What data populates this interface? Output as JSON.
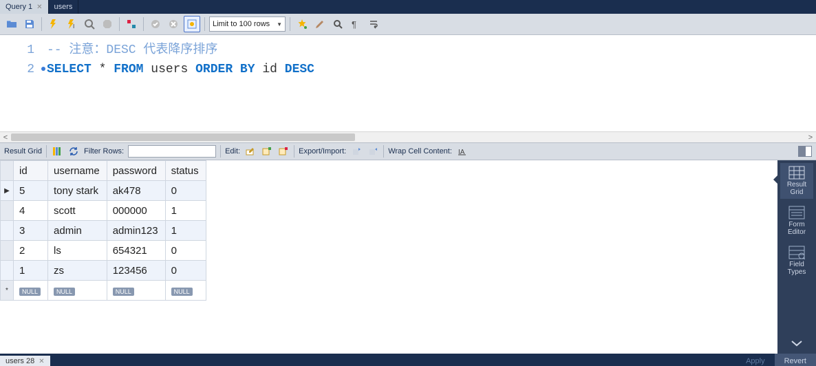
{
  "tabs": {
    "main": [
      {
        "label": "Query 1",
        "active": true,
        "closable": true
      },
      {
        "label": "users",
        "active": false,
        "closable": false
      }
    ]
  },
  "toolbar": {
    "limit_label": "Limit to 100 rows"
  },
  "editor": {
    "lines": [
      {
        "num": "1",
        "bp": false,
        "comment": "-- 注意：DESC 代表降序排序"
      },
      {
        "num": "2",
        "bp": true
      }
    ],
    "sql_tokens": {
      "select": "SELECT",
      "star": "*",
      "from": "FROM",
      "table": "users",
      "order_by": "ORDER BY",
      "col": "id",
      "desc": "DESC"
    }
  },
  "result_toolbar": {
    "label_result_grid": "Result Grid",
    "label_filter_rows": "Filter Rows:",
    "filter_value": "",
    "label_edit": "Edit:",
    "label_export": "Export/Import:",
    "label_wrap": "Wrap Cell Content:"
  },
  "grid": {
    "columns": [
      "id",
      "username",
      "password",
      "status"
    ],
    "rows": [
      {
        "marker": "▶",
        "cells": [
          "5",
          "tony stark",
          "ak478",
          "0"
        ]
      },
      {
        "marker": "",
        "cells": [
          "4",
          "scott",
          "000000",
          "1"
        ]
      },
      {
        "marker": "",
        "cells": [
          "3",
          "admin",
          "admin123",
          "1"
        ]
      },
      {
        "marker": "",
        "cells": [
          "2",
          "ls",
          "654321",
          "0"
        ]
      },
      {
        "marker": "",
        "cells": [
          "1",
          "zs",
          "123456",
          "0"
        ]
      }
    ],
    "null_label": "NULL",
    "new_row_marker": "*"
  },
  "side_panel": {
    "result_grid": "Result\nGrid",
    "form_editor": "Form\nEditor",
    "field_types": "Field\nTypes"
  },
  "footer": {
    "tab_label": "users 28",
    "apply": "Apply",
    "revert": "Revert"
  }
}
